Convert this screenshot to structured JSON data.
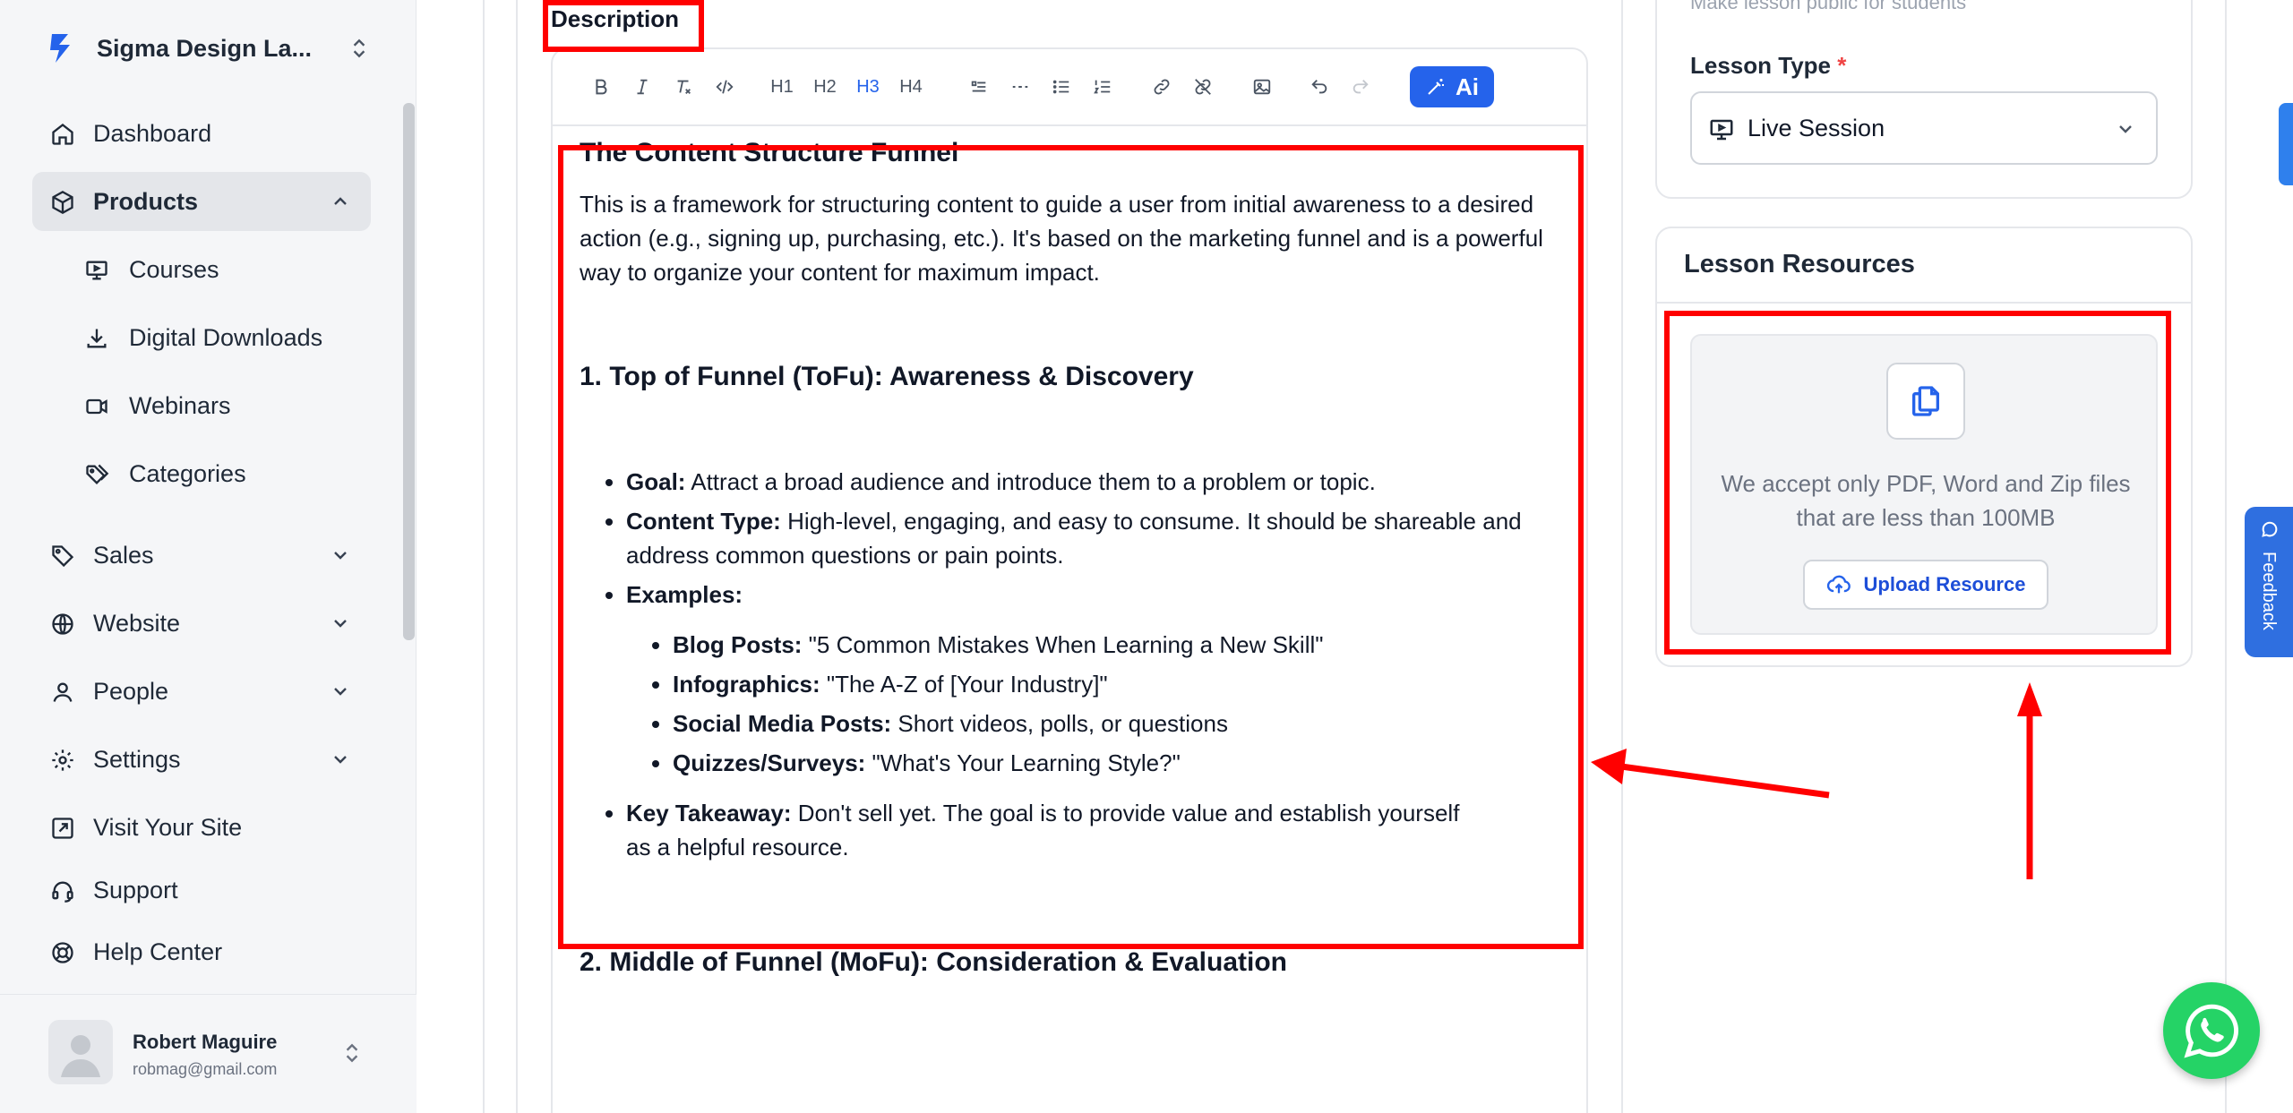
{
  "sidebar": {
    "brand": "Sigma Design La...",
    "items": [
      {
        "label": "Dashboard",
        "icon": "home-icon"
      },
      {
        "label": "Products",
        "icon": "box-icon"
      },
      {
        "label": "Courses",
        "icon": "presentation-icon"
      },
      {
        "label": "Digital Downloads",
        "icon": "download-icon"
      },
      {
        "label": "Webinars",
        "icon": "video-icon"
      },
      {
        "label": "Categories",
        "icon": "tags-icon"
      },
      {
        "label": "Sales",
        "icon": "tag-icon"
      },
      {
        "label": "Website",
        "icon": "globe-icon"
      },
      {
        "label": "People",
        "icon": "user-icon"
      },
      {
        "label": "Settings",
        "icon": "gear-icon"
      },
      {
        "label": "Visit Your Site",
        "icon": "external-link-icon"
      },
      {
        "label": "Support",
        "icon": "headset-icon"
      },
      {
        "label": "Help Center",
        "icon": "lifebuoy-icon"
      }
    ],
    "user": {
      "name": "Robert Maguire",
      "email": "robmag@gmail.com"
    }
  },
  "editor": {
    "label": "Description",
    "toolbar": {
      "ai_label": "Ai",
      "h1": "H1",
      "h2": "H2",
      "h3": "H3",
      "h4": "H4"
    },
    "content": {
      "title": "The Content Structure Funnel",
      "intro": "This is a framework for structuring content to guide a user from initial awareness to a desired action (e.g., signing up, purchasing, etc.). It's based on the marketing funnel and is a powerful way to organize your content for maximum impact.",
      "section1_heading": "1. Top of Funnel (ToFu): Awareness & Discovery",
      "goal_label": "Goal:",
      "goal_text": " Attract a broad audience and introduce them to a problem or topic.",
      "content_type_label": "Content Type:",
      "content_type_text": " High-level, engaging, and easy to consume. It should be shareable and address common questions or pain points.",
      "examples_label": "Examples:",
      "examples": [
        {
          "label": "Blog Posts:",
          "text": " \"5 Common Mistakes When Learning a New Skill\""
        },
        {
          "label": "Infographics:",
          "text": " \"The A-Z of [Your Industry]\""
        },
        {
          "label": "Social Media Posts:",
          "text": " Short videos, polls, or questions"
        },
        {
          "label": "Quizzes/Surveys:",
          "text": " \"What's Your Learning Style?\""
        }
      ],
      "takeaway_label": "Key Takeaway:",
      "takeaway_text": " Don't sell yet. The goal is to provide value and establish yourself as a helpful resource.",
      "section2_heading": "2. Middle of Funnel (MoFu): Consideration & Evaluation"
    }
  },
  "right_panel": {
    "public_text": "Make lesson public for students",
    "lesson_type_label": "Lesson Type",
    "required_mark": "*",
    "lesson_type_value": "Live Session",
    "resources_title": "Lesson Resources",
    "dropzone_text": "We accept only PDF, Word and Zip files that are less than 100MB",
    "upload_label": "Upload Resource"
  },
  "feedback_label": "Feedback",
  "colors": {
    "accent": "#2563eb",
    "annotation": "#ff0000",
    "whatsapp": "#25d366"
  }
}
